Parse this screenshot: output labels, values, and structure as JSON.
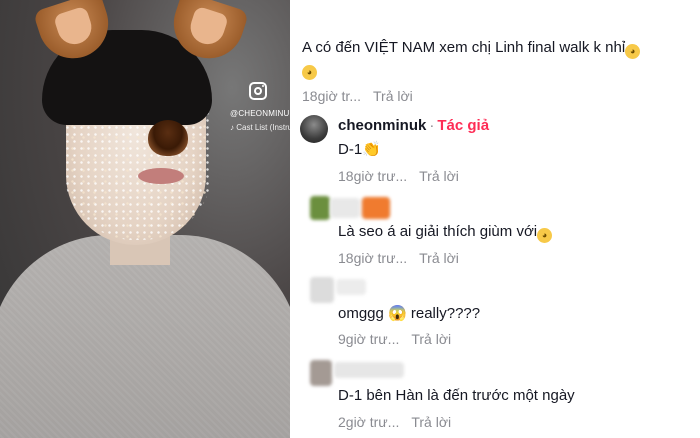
{
  "video": {
    "handle": "@CHEONMINUK",
    "music": "♪ Cast List (Instrum"
  },
  "comments": {
    "top": {
      "text_line1": "A có đến VIỆT NAM xem chị Linh final walk k nhỉ",
      "time": "18giờ tr...",
      "reply": "Trả lời"
    },
    "author_reply": {
      "username": "cheonminuk",
      "separator": "·",
      "author_tag": "Tác giả",
      "text": "D-1",
      "time": "18giờ trư...",
      "reply": "Trả lời"
    },
    "reply2": {
      "text": "Là seo á ai giải thích giùm với",
      "time": "18giờ trư...",
      "reply": "Trả lời"
    },
    "reply3": {
      "text": "omggg 😱 really????",
      "time": "9giờ trư...",
      "reply": "Trả lời"
    },
    "reply4": {
      "text": "D-1 bên Hàn là đến trước một ngày",
      "time": "2giờ trư...",
      "reply": "Trả lời"
    }
  },
  "colors": {
    "author_tag": "#fe2c55",
    "meta_gray": "#8a8b91",
    "text": "#161823"
  },
  "icons": [
    "instagram-icon",
    "pleading-face-emoji",
    "clapping-hands-emoji",
    "screaming-face-emoji"
  ]
}
